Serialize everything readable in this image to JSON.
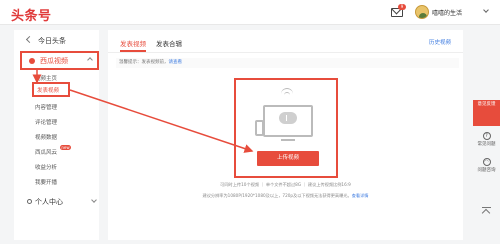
{
  "header": {
    "logo": "头条号",
    "mail_badge": "9",
    "username": "嘻嘻的生活"
  },
  "sidebar": {
    "home": "今日头条",
    "group_label": "西瓜视频",
    "items": [
      "视频主页",
      "发表视频",
      "内容管理",
      "评论管理",
      "视频数据",
      "西瓜风云",
      "收益分析",
      "我要开播"
    ],
    "new_badge": "new",
    "personal": "个人中心"
  },
  "main": {
    "tabs": [
      "发表视频",
      "发表合辑"
    ],
    "history_link": "历史视频",
    "notice_prefix": "温馨提示：发表视频前，",
    "notice_link": "请查看",
    "upload_button": "上传视频",
    "footnote1": "可同时上传10个视频  ｜  单个文件不超过8G  ｜  建议上传视频比例16:9",
    "footnote2_text": "建议分辨率为1080P/1920*1080及以上，720p及以下视频无法获得更高曝光。",
    "footnote2_link": "查看详情"
  },
  "right_float": {
    "feedback": "意见反馈",
    "faq": "常见问题",
    "consult": "问题咨询"
  },
  "colors": {
    "accent": "#e74c3c",
    "link": "#3d7be0"
  }
}
